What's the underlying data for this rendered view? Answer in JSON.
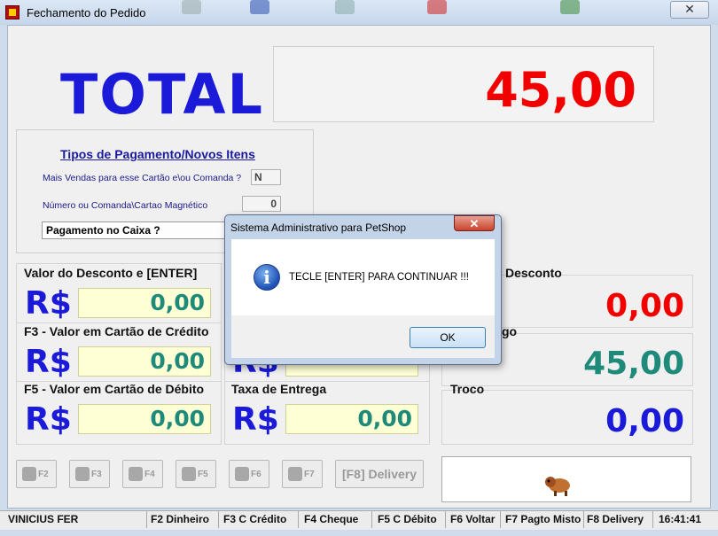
{
  "window": {
    "title": "Fechamento do Pedido",
    "close_glyph": "✕"
  },
  "total": {
    "label": "TOTAL",
    "value": "45,00"
  },
  "payment": {
    "title": "Tipos de Pagamento/Novos Itens",
    "more_sales_label": "Mais Vendas para esse Cartão e\\ou Comanda ?",
    "more_sales_value": "N",
    "number_label": "Número ou Comanda\\Cartao Magnético",
    "number_value": "0",
    "select_value": "Pagamento no Caixa ?"
  },
  "left_panels": [
    {
      "label": "Valor do Desconto e [ENTER]",
      "currency": "R$",
      "value": "0,00"
    },
    {
      "label": "F3 - Valor em Cartão de Crédito",
      "currency": "R$",
      "value": "0,00"
    },
    {
      "label": "F5 - Valor em Cartão de Débito",
      "currency": "R$",
      "value": "0,00"
    }
  ],
  "middle_panels": [
    {
      "label": "Taxa de Entrega",
      "currency": "R$",
      "value": "0,00"
    }
  ],
  "right_panels": [
    {
      "label": "Desconto",
      "value": "0,00",
      "color": "#f20000"
    },
    {
      "label": "go",
      "value": "45,00",
      "color": "#1d8a7a"
    },
    {
      "label": "Troco",
      "value": "0,00",
      "color": "#1a1ad8"
    }
  ],
  "toolbar": {
    "buttons": [
      {
        "key": "F2",
        "icon": "cash-icon"
      },
      {
        "key": "F3",
        "icon": "credit-card-icon"
      },
      {
        "key": "F4",
        "icon": "keyboard-icon"
      },
      {
        "key": "F5",
        "icon": "grid-icon"
      },
      {
        "key": "F6",
        "icon": "return-icon"
      },
      {
        "key": "F7",
        "icon": "mixed-payment-icon"
      }
    ],
    "delivery_label": "[F8] Delivery"
  },
  "status_bar": [
    "VINICIUS FER",
    "F2 Dinheiro",
    "F3 C Crédito",
    "F4 Cheque",
    "F5 C Débito",
    "F6 Voltar",
    "F7 Pagto Misto",
    "F8 Delivery",
    "16:41:41"
  ],
  "dialog": {
    "title": "Sistema Administrativo para PetShop",
    "close_glyph": "✕",
    "message": "TECLE [ENTER] PARA CONTINUAR !!!",
    "ok_label": "OK",
    "icon_glyph": "i"
  }
}
